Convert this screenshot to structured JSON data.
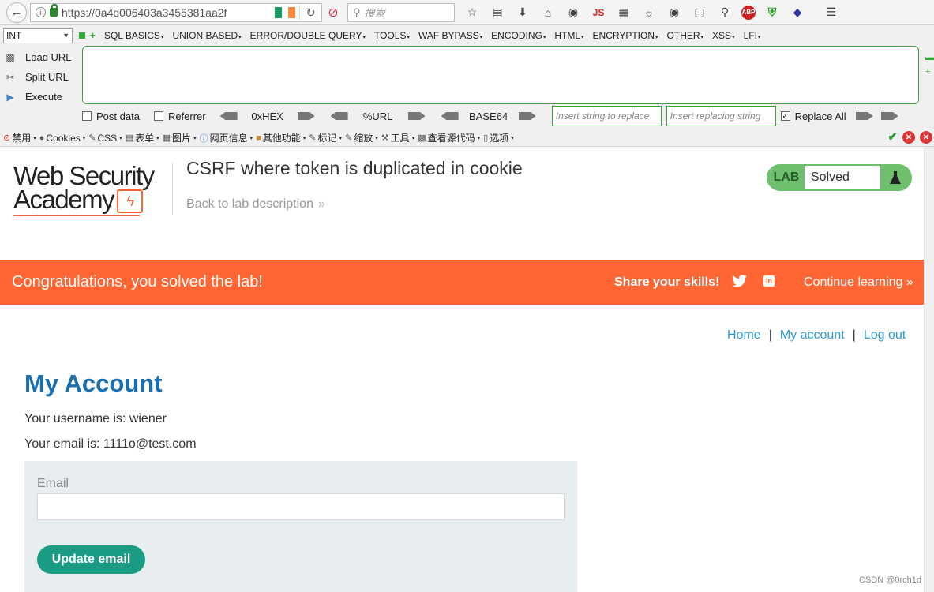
{
  "browser": {
    "url": "https://0a4d006403a3455381aa2f",
    "search_placeholder": "搜索",
    "reload_icon": "reload-icon",
    "icons": [
      "bookmark-star-icon",
      "reading-list-icon",
      "download-icon",
      "home-icon",
      "globe-icon",
      "javascript-icon",
      "image-icon",
      "palette-icon",
      "eye-icon",
      "screenshot-icon",
      "search-icon",
      "adblock-icon",
      "shield-icon",
      "extension-icon",
      "menu-icon"
    ],
    "js_label": "JS",
    "abp_label": "ABP",
    "flag_colors": [
      "#169b62",
      "#ffffff",
      "#ff883e"
    ]
  },
  "hackbar": {
    "selected": "INT",
    "menu": [
      "SQL BASICS",
      "UNION BASED",
      "ERROR/DOUBLE QUERY",
      "TOOLS",
      "WAF BYPASS",
      "ENCODING",
      "HTML",
      "ENCRYPTION",
      "OTHER",
      "XSS",
      "LFI"
    ],
    "side": [
      "Load URL",
      "Split URL",
      "Execute"
    ],
    "post_data": "Post data",
    "referrer": "Referrer",
    "enc_hex": "0xHEX",
    "enc_url": "%URL",
    "enc_base64": "BASE64",
    "replace_placeholder": "Insert string to replace",
    "replacing_placeholder": "Insert replacing string",
    "replace_all": "Replace All",
    "accent": "#3fa03f"
  },
  "addons": {
    "items": [
      "禁用",
      "Cookies",
      "CSS",
      "表单",
      "图片",
      "网页信息",
      "其他功能",
      "标记",
      "缩放",
      "工具",
      "查看源代码",
      "选项"
    ]
  },
  "lab": {
    "logo_line1": "Web Security",
    "logo_line2": "Academy",
    "title": "CSRF where token is duplicated in cookie",
    "back_link": "Back to lab description",
    "badge_lab": "LAB",
    "badge_status": "Solved",
    "badge_color": "#6ec06e"
  },
  "banner": {
    "congrats": "Congratulations, you solved the lab!",
    "share": "Share your skills!",
    "continue": "Continue learning",
    "color": "#ff6633"
  },
  "nav": {
    "home": "Home",
    "sep1": "|",
    "account": "My account",
    "sep2": "|",
    "logout": "Log out"
  },
  "account": {
    "heading": "My Account",
    "username_line": "Your username is: wiener",
    "email_line": "Your email is: 1111o@test.com",
    "email_label": "Email",
    "email_value": "",
    "update_button": "Update email",
    "button_color": "#1a9c84"
  },
  "watermark": "CSDN @0rch1d"
}
